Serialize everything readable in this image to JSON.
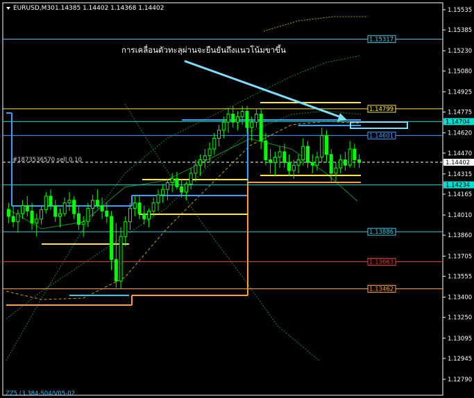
{
  "header": {
    "symbol": "EURUSD,M30",
    "ohlc": "1.14385 1.14402 1.14368 1.14402"
  },
  "annotation": "การเคลื่อนตัวทะลุผ่านจะยืนยันถึงแนวโน้มขาขึ้น",
  "order_label": "#1873536570 sell 0.10",
  "footer_text": "ZZ5 (3.384-S04/V05-02",
  "colors": {
    "background": "#000000",
    "bull": "#00ff00",
    "bear": "#00ff00",
    "axis": "#ffffff",
    "annotation_arrow": "#7fdfff"
  },
  "chart_data": {
    "type": "candlestick",
    "symbol": "EURUSD",
    "timeframe": "M30",
    "ylim": [
      1.1275,
      1.156
    ],
    "y_ticks": [
      "1.15535",
      "1.15230",
      "1.14925",
      "1.14620",
      "1.14315",
      "1.14010",
      "1.13705",
      "1.13400",
      "1.13095",
      "1.12790",
      "1.15230",
      "1.15535",
      "1.14620",
      "1.14315",
      "1.14010",
      "1.13705",
      "1.13400",
      "1.13095",
      "1.12790"
    ],
    "axis_ticks": [
      {
        "label": "1.15535",
        "value": 1.15535
      },
      {
        "label": "1.15230",
        "value": 1.1523
      },
      {
        "label": "1.14925",
        "value": 1.14925
      },
      {
        "label": "1.14620",
        "value": 1.1462
      },
      {
        "label": "1.14315",
        "value": 1.14315
      },
      {
        "label": "1.14010",
        "value": 1.1401
      },
      {
        "label": "1.13705",
        "value": 1.13705
      },
      {
        "label": "1.13400",
        "value": 1.134
      },
      {
        "label": "1.13095",
        "value": 1.13095
      },
      {
        "label": "1.12790",
        "value": 1.1279
      },
      {
        "label": "1.15385",
        "value": 1.15385
      },
      {
        "label": "1.15080",
        "value": 1.1508
      },
      {
        "label": "1.14775",
        "value": 1.14775
      },
      {
        "label": "1.14470",
        "value": 1.1447
      },
      {
        "label": "1.14165",
        "value": 1.14165
      },
      {
        "label": "1.13860",
        "value": 1.1386
      },
      {
        "label": "1.13555",
        "value": 1.13555
      },
      {
        "label": "1.13250",
        "value": 1.1325
      },
      {
        "label": "1.12945",
        "value": 1.12945
      }
    ],
    "price_levels": [
      {
        "label": "1.15317",
        "value": 1.15317,
        "color": "#4fc8e8"
      },
      {
        "label": "1.14799",
        "value": 1.14799,
        "color": "#ffe44a"
      },
      {
        "label": "1.14704",
        "value": 1.14704,
        "color": "#00e0d0",
        "highlight": true
      },
      {
        "label": "1.14601",
        "value": 1.14601,
        "color": "#3aa0ff"
      },
      {
        "label": "1.14402",
        "value": 1.14402,
        "color": "#ffffff",
        "highlight": true
      },
      {
        "label": "1.14234",
        "value": 1.14234,
        "color": "#00e0d0",
        "highlight": true
      },
      {
        "label": "1.13886",
        "value": 1.13886,
        "color": "#3ac8e8"
      },
      {
        "label": "1.13663",
        "value": 1.13663,
        "color": "#e83a2a"
      },
      {
        "label": "1.13462",
        "value": 1.13462,
        "color": "#ffa030"
      }
    ],
    "candles": [
      [
        1.1405,
        1.141,
        1.1395,
        1.14
      ],
      [
        1.14,
        1.1408,
        1.1392,
        1.1396
      ],
      [
        1.1396,
        1.1405,
        1.1388,
        1.1402
      ],
      [
        1.1402,
        1.1412,
        1.1398,
        1.1408
      ],
      [
        1.1408,
        1.1415,
        1.14,
        1.1404
      ],
      [
        1.1404,
        1.141,
        1.139,
        1.1395
      ],
      [
        1.1395,
        1.1402,
        1.1385,
        1.1398
      ],
      [
        1.1398,
        1.1408,
        1.1394,
        1.1405
      ],
      [
        1.1405,
        1.1418,
        1.1402,
        1.1415
      ],
      [
        1.1415,
        1.142,
        1.1405,
        1.1408
      ],
      [
        1.1408,
        1.1412,
        1.1396,
        1.14
      ],
      [
        1.14,
        1.1406,
        1.1392,
        1.1402
      ],
      [
        1.1402,
        1.1414,
        1.14,
        1.141
      ],
      [
        1.141,
        1.1418,
        1.1404,
        1.1412
      ],
      [
        1.1412,
        1.1415,
        1.1398,
        1.1402
      ],
      [
        1.1402,
        1.1408,
        1.139,
        1.1394
      ],
      [
        1.1394,
        1.14,
        1.1385,
        1.1396
      ],
      [
        1.1396,
        1.141,
        1.1392,
        1.1406
      ],
      [
        1.1406,
        1.1416,
        1.14,
        1.1412
      ],
      [
        1.1412,
        1.142,
        1.1406,
        1.1408
      ],
      [
        1.1408,
        1.1414,
        1.1398,
        1.1404
      ],
      [
        1.1404,
        1.141,
        1.1395,
        1.14
      ],
      [
        1.14,
        1.1404,
        1.136,
        1.1368
      ],
      [
        1.1368,
        1.1395,
        1.1347,
        1.1352
      ],
      [
        1.1352,
        1.1392,
        1.1346,
        1.1385
      ],
      [
        1.1385,
        1.14,
        1.1378,
        1.1396
      ],
      [
        1.1396,
        1.141,
        1.139,
        1.1406
      ],
      [
        1.1406,
        1.1415,
        1.14,
        1.141
      ],
      [
        1.141,
        1.1416,
        1.1398,
        1.1402
      ],
      [
        1.1402,
        1.1408,
        1.1394,
        1.1398
      ],
      [
        1.1398,
        1.1406,
        1.1392,
        1.1404
      ],
      [
        1.1404,
        1.1414,
        1.14,
        1.141
      ],
      [
        1.141,
        1.142,
        1.1404,
        1.1416
      ],
      [
        1.1416,
        1.1424,
        1.141,
        1.142
      ],
      [
        1.142,
        1.1428,
        1.1412,
        1.1425
      ],
      [
        1.1425,
        1.1432,
        1.1418,
        1.1428
      ],
      [
        1.1428,
        1.1433,
        1.142,
        1.1422
      ],
      [
        1.1422,
        1.1428,
        1.1414,
        1.1418
      ],
      [
        1.1418,
        1.1426,
        1.1412,
        1.1424
      ],
      [
        1.1424,
        1.1436,
        1.142,
        1.1432
      ],
      [
        1.1432,
        1.1442,
        1.1426,
        1.1438
      ],
      [
        1.1438,
        1.1446,
        1.143,
        1.1442
      ],
      [
        1.1442,
        1.145,
        1.1436,
        1.1445
      ],
      [
        1.1445,
        1.1455,
        1.144,
        1.145
      ],
      [
        1.145,
        1.1462,
        1.1446,
        1.1458
      ],
      [
        1.1458,
        1.1468,
        1.1452,
        1.1464
      ],
      [
        1.1464,
        1.1474,
        1.1458,
        1.147
      ],
      [
        1.147,
        1.148,
        1.1462,
        1.1476
      ],
      [
        1.1476,
        1.1482,
        1.1466,
        1.147
      ],
      [
        1.147,
        1.1478,
        1.1464,
        1.1474
      ],
      [
        1.1474,
        1.1482,
        1.1468,
        1.1478
      ],
      [
        1.1478,
        1.1482,
        1.1462,
        1.1466
      ],
      [
        1.1466,
        1.1474,
        1.1456,
        1.147
      ],
      [
        1.147,
        1.148,
        1.1466,
        1.1476
      ],
      [
        1.1476,
        1.148,
        1.145,
        1.1456
      ],
      [
        1.1456,
        1.1462,
        1.1438,
        1.1442
      ],
      [
        1.1442,
        1.145,
        1.1432,
        1.144
      ],
      [
        1.144,
        1.1448,
        1.143,
        1.1444
      ],
      [
        1.1444,
        1.1452,
        1.1436,
        1.1448
      ],
      [
        1.1448,
        1.1454,
        1.1436,
        1.144
      ],
      [
        1.144,
        1.1446,
        1.143,
        1.1434
      ],
      [
        1.1434,
        1.1442,
        1.1428,
        1.1438
      ],
      [
        1.1438,
        1.1446,
        1.1432,
        1.1442
      ],
      [
        1.1442,
        1.1458,
        1.1438,
        1.1452
      ],
      [
        1.1452,
        1.1456,
        1.1436,
        1.144
      ],
      [
        1.144,
        1.1446,
        1.1432,
        1.1438
      ],
      [
        1.1438,
        1.1448,
        1.1434,
        1.1444
      ],
      [
        1.1444,
        1.1466,
        1.144,
        1.146
      ],
      [
        1.146,
        1.1464,
        1.144,
        1.1446
      ],
      [
        1.1446,
        1.145,
        1.1426,
        1.1432
      ],
      [
        1.1432,
        1.144,
        1.1426,
        1.1436
      ],
      [
        1.1436,
        1.1446,
        1.1432,
        1.1442
      ],
      [
        1.1442,
        1.1448,
        1.1434,
        1.1438
      ],
      [
        1.1438,
        1.1456,
        1.1436,
        1.145
      ],
      [
        1.145,
        1.1454,
        1.1436,
        1.1442
      ],
      [
        1.1442,
        1.1446,
        1.1436,
        1.144
      ]
    ]
  }
}
